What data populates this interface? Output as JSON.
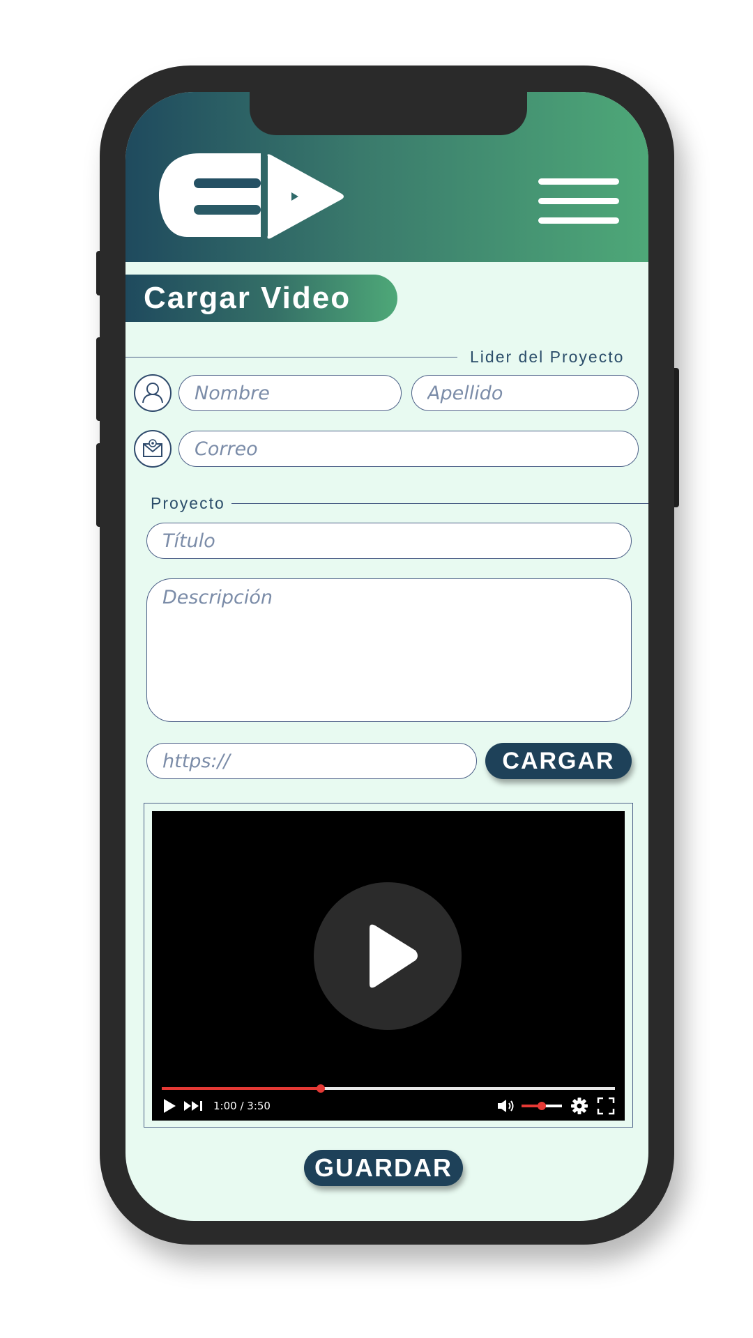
{
  "header": {
    "logo_icon": "ep-logo-icon",
    "menu_icon": "hamburger-menu-icon"
  },
  "page": {
    "title": "Cargar Video"
  },
  "leader_section": {
    "label": "Lider del Proyecto",
    "user_icon": "user-icon",
    "mail_icon": "envelope-icon",
    "first_name_placeholder": "Nombre",
    "last_name_placeholder": "Apellido",
    "email_placeholder": "Correo"
  },
  "project_section": {
    "label": "Proyecto",
    "title_placeholder": "Título",
    "description_placeholder": "Descripción",
    "url_placeholder": "https://",
    "load_button": "CARGAR"
  },
  "video_player": {
    "current_time": "1:00",
    "duration": "3:50",
    "time_display": "1:00 / 3:50",
    "progress_fraction": 0.35,
    "volume_fraction": 0.5,
    "icons": [
      "play-icon",
      "next-icon",
      "volume-icon",
      "settings-icon",
      "fullscreen-icon"
    ]
  },
  "footer": {
    "save_button": "GUARDAR"
  },
  "colors": {
    "brand_dark": "#1e4159",
    "brand_green": "#4ea878",
    "background": "#e8faf1",
    "accent_red": "#e53935"
  }
}
